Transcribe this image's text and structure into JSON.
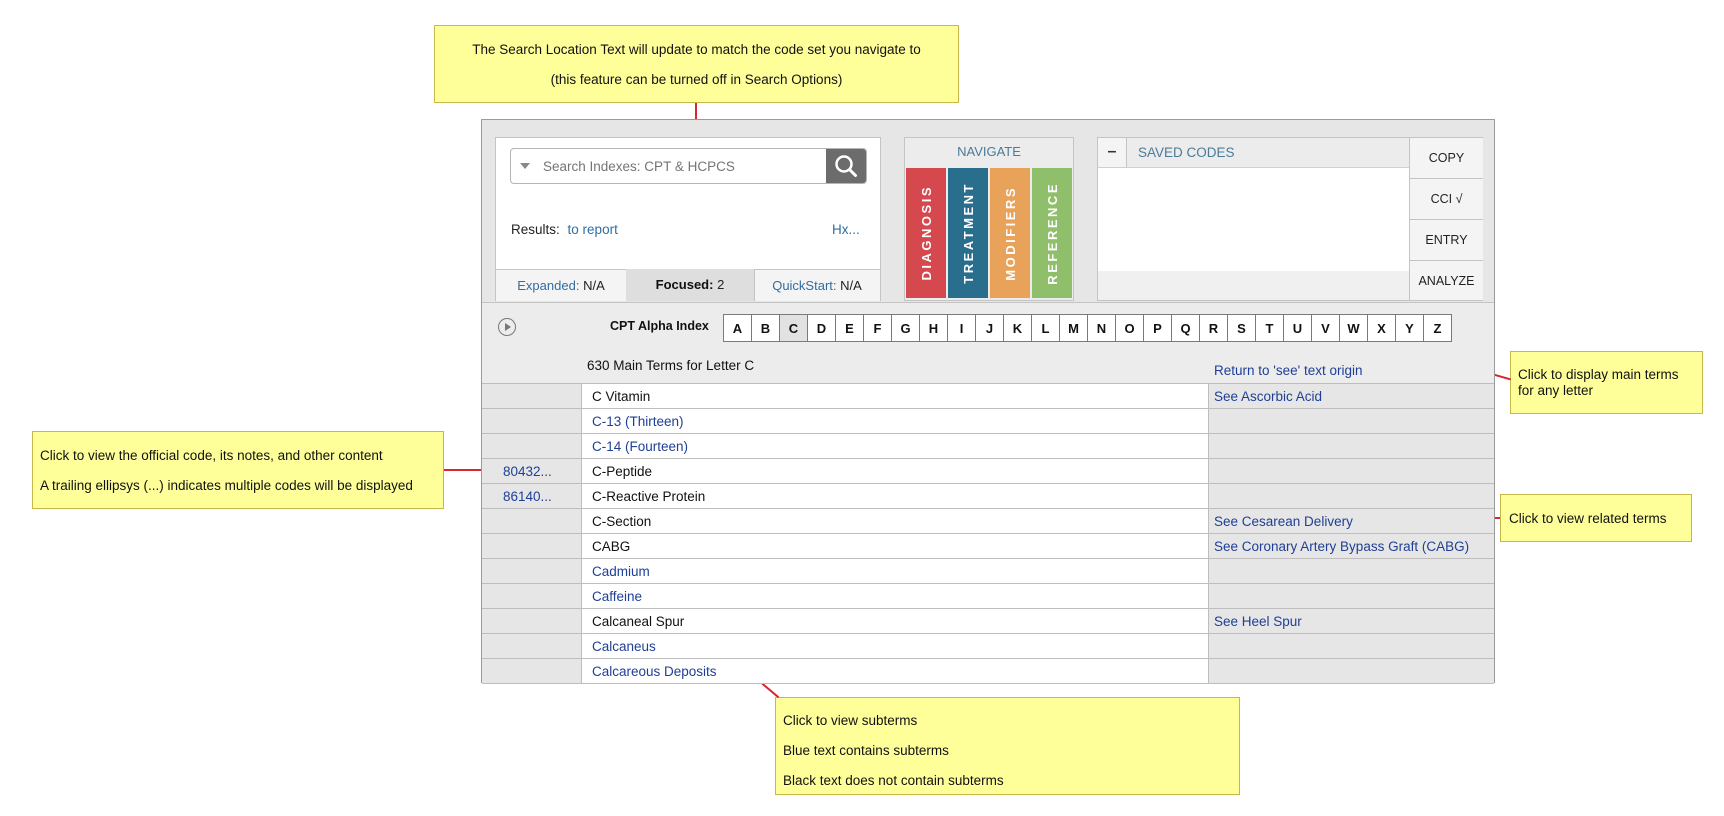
{
  "annotations": {
    "search_location": [
      "The Search Location Text will update to match the code set you navigate to",
      "(this feature can be turned off in Search Options)"
    ],
    "main_terms": [
      "Click to display main terms",
      "for any letter"
    ],
    "official_code": [
      "Click to view the official code, its notes, and other content",
      "A trailing ellipsys (...) indicates multiple codes will be displayed"
    ],
    "related_terms": [
      "Click to view related terms"
    ],
    "subterms": [
      "Click to view subterms",
      "Blue text contains subterms",
      "Black text does not contain subterms"
    ]
  },
  "search": {
    "placeholder": "Search Indexes: CPT & HCPCS",
    "results_label": "Results:",
    "results_link": "to report",
    "history_link": "Hx...",
    "icons": {
      "dropdown": "dropdown-triangle-icon",
      "search": "magnifier-icon"
    },
    "tabs": [
      {
        "label": "Expanded:",
        "value": "N/A"
      },
      {
        "label": "Focused:",
        "value": "2"
      },
      {
        "label": "QuickStart:",
        "value": "N/A"
      }
    ]
  },
  "navigate": {
    "title": "NAVIGATE",
    "items": [
      {
        "label": "DIAGNOSIS",
        "color": "#d4484e"
      },
      {
        "label": "TREATMENT",
        "color": "#2a6e8e"
      },
      {
        "label": "MODIFIERS",
        "color": "#e9a25a"
      },
      {
        "label": "REFERENCE",
        "color": "#8fbf6a"
      }
    ]
  },
  "saved_codes": {
    "collapse_symbol": "–",
    "title": "SAVED CODES",
    "buttons": [
      "COPY",
      "CCI √",
      "ENTRY",
      "ANALYZE"
    ]
  },
  "alpha": {
    "title": "CPT Alpha Index",
    "letters": [
      "A",
      "B",
      "C",
      "D",
      "E",
      "F",
      "G",
      "H",
      "I",
      "J",
      "K",
      "L",
      "M",
      "N",
      "O",
      "P",
      "Q",
      "R",
      "S",
      "T",
      "U",
      "V",
      "W",
      "X",
      "Y",
      "Z"
    ],
    "active": "C"
  },
  "list": {
    "header": "630 Main Terms for Letter C",
    "return_link": "Return to 'see' text origin",
    "rows": [
      {
        "code": "",
        "term": "C Vitamin",
        "has_subterms": false,
        "see": "See Ascorbic Acid"
      },
      {
        "code": "",
        "term": "C-13 (Thirteen)",
        "has_subterms": true,
        "see": ""
      },
      {
        "code": "",
        "term": "C-14 (Fourteen)",
        "has_subterms": true,
        "see": ""
      },
      {
        "code": "80432...",
        "term": "C-Peptide",
        "has_subterms": false,
        "see": ""
      },
      {
        "code": "86140...",
        "term": "C-Reactive Protein",
        "has_subterms": false,
        "see": ""
      },
      {
        "code": "",
        "term": "C-Section",
        "has_subterms": false,
        "see": "See Cesarean Delivery"
      },
      {
        "code": "",
        "term": "CABG",
        "has_subterms": false,
        "see": "See Coronary Artery Bypass Graft (CABG)"
      },
      {
        "code": "",
        "term": "Cadmium",
        "has_subterms": true,
        "see": ""
      },
      {
        "code": "",
        "term": "Caffeine",
        "has_subterms": true,
        "see": ""
      },
      {
        "code": "",
        "term": "Calcaneal Spur",
        "has_subterms": false,
        "see": "See Heel Spur"
      },
      {
        "code": "",
        "term": "Calcaneus",
        "has_subterms": true,
        "see": ""
      },
      {
        "code": "",
        "term": "Calcareous Deposits",
        "has_subterms": true,
        "see": ""
      }
    ]
  }
}
